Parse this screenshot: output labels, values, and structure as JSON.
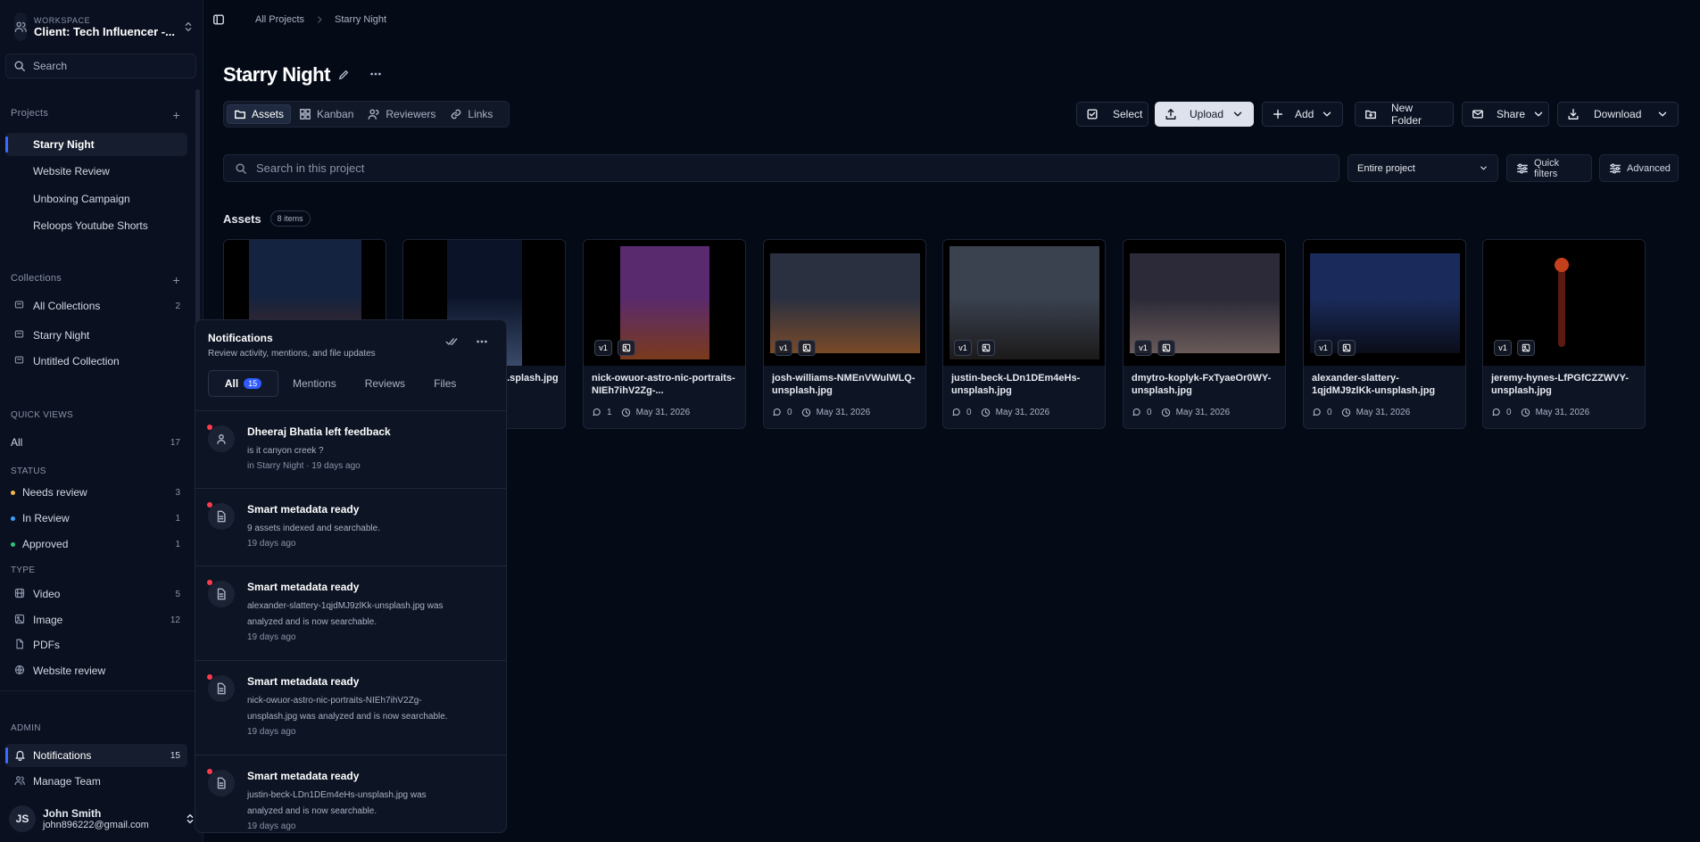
{
  "sidebar": {
    "workspace_label": "WORKSPACE",
    "workspace_name": "Client: Tech Influencer -...",
    "search_label": "Search",
    "projects_heading": "Projects",
    "projects": [
      "Starry Night",
      "Website Review",
      "Unboxing Campaign",
      "Reloops Youtube Shorts"
    ],
    "collections_heading": "Collections",
    "collections": [
      {
        "label": "All Collections",
        "count": "2"
      },
      {
        "label": "Starry Night",
        "count": ""
      },
      {
        "label": "Untitled Collection",
        "count": ""
      }
    ],
    "quick_views_heading": "QUICK VIEWS",
    "quick_all": {
      "label": "All",
      "count": "17"
    },
    "status_heading": "STATUS",
    "status": [
      {
        "label": "Needs review",
        "count": "3",
        "color": "#f2b84b"
      },
      {
        "label": "In Review",
        "count": "1",
        "color": "#3aa0ff"
      },
      {
        "label": "Approved",
        "count": "1",
        "color": "#2ec27e"
      }
    ],
    "type_heading": "TYPE",
    "types": [
      {
        "label": "Video",
        "count": "5",
        "icon": "video-icon"
      },
      {
        "label": "Image",
        "count": "12",
        "icon": "image-icon"
      },
      {
        "label": "PDFs",
        "count": "",
        "icon": "pdf-icon"
      },
      {
        "label": "Website review",
        "count": "",
        "icon": "globe-icon"
      }
    ],
    "admin_heading": "ADMIN",
    "admin": [
      {
        "label": "Notifications",
        "count": "15",
        "icon": "bell-icon"
      },
      {
        "label": "Manage Team",
        "count": "",
        "icon": "users-icon"
      }
    ],
    "user": {
      "initials": "JS",
      "name": "John Smith",
      "email": "john896222@gmail.com"
    }
  },
  "breadcrumb": {
    "root": "All Projects",
    "current": "Starry Night"
  },
  "project_title": "Starry Night",
  "view_tabs": [
    "Assets",
    "Kanban",
    "Reviewers",
    "Links"
  ],
  "toolbar": {
    "select": "Select",
    "upload": "Upload",
    "add": "Add",
    "new_folder": "New Folder",
    "share": "Share",
    "download": "Download"
  },
  "search": {
    "placeholder": "Search in this project",
    "scope": "Entire project",
    "quick_filters": "Quick filters",
    "advanced": "Advanced"
  },
  "assets_heading": "Assets",
  "assets_count": "8 items",
  "assets": [
    {
      "name": "",
      "comments": "",
      "date": "",
      "version": "",
      "colors": [
        "#14233f",
        "#5a2a1c"
      ]
    },
    {
      "name": "...splash.jpg",
      "comments": "",
      "date": "",
      "version": "",
      "colors": [
        "#0a1328",
        "#3a4a6a"
      ]
    },
    {
      "name": "nick-owuor-astro-nic-portraits-NIEh7ihV2Zg-...",
      "comments": "1",
      "date": "May 31, 2026",
      "version": "v1",
      "colors": [
        "#5a2a6e",
        "#7a3a1c"
      ]
    },
    {
      "name": "josh-williams-NMEnVWulWLQ-unsplash.jpg",
      "comments": "0",
      "date": "May 31, 2026",
      "version": "v1",
      "colors": [
        "#2a3040",
        "#7a4a28"
      ]
    },
    {
      "name": "justin-beck-LDn1DEm4eHs-unsplash.jpg",
      "comments": "0",
      "date": "May 31, 2026",
      "version": "v1",
      "colors": [
        "#3a4250",
        "#1c1a1a"
      ]
    },
    {
      "name": "dmytro-koplyk-FxTyaeOr0WY-unsplash.jpg",
      "comments": "0",
      "date": "May 31, 2026",
      "version": "v1",
      "colors": [
        "#2c2a38",
        "#6a5a58"
      ]
    },
    {
      "name": "alexander-slattery-1qjdMJ9zlKk-unsplash.jpg",
      "comments": "0",
      "date": "May 31, 2026",
      "version": "v1",
      "colors": [
        "#1a2a5a",
        "#0a0d18"
      ]
    },
    {
      "name": "jeremy-hynes-LfPGfCZZWVY-unsplash.jpg",
      "comments": "0",
      "date": "May 31, 2026",
      "version": "v1",
      "colors": [
        "#000000",
        "#000000"
      ]
    }
  ],
  "notifications": {
    "title": "Notifications",
    "subtitle": "Review activity, mentions, and file updates",
    "tabs": [
      "All",
      "Mentions",
      "Reviews",
      "Files"
    ],
    "all_count": "15",
    "items": [
      {
        "title": "Dheeraj Bhatia left feedback",
        "desc": "is it canyon creek ?",
        "time": "in Starry Night · 19 days ago",
        "icon": "user-icon"
      },
      {
        "title": "Smart metadata ready",
        "desc": "9 assets indexed and searchable.",
        "time": "19 days ago",
        "icon": "document-icon"
      },
      {
        "title": "Smart metadata ready",
        "desc": "alexander-slattery-1qjdMJ9zlKk-unsplash.jpg was analyzed and is now searchable.",
        "time": "19 days ago",
        "icon": "document-icon"
      },
      {
        "title": "Smart metadata ready",
        "desc": "nick-owuor-astro-nic-portraits-NIEh7ihV2Zg-unsplash.jpg was analyzed and is now searchable.",
        "time": "19 days ago",
        "icon": "document-icon"
      },
      {
        "title": "Smart metadata ready",
        "desc": "justin-beck-LDn1DEm4eHs-unsplash.jpg was analyzed and is now searchable.",
        "time": "19 days ago",
        "icon": "document-icon"
      }
    ]
  }
}
